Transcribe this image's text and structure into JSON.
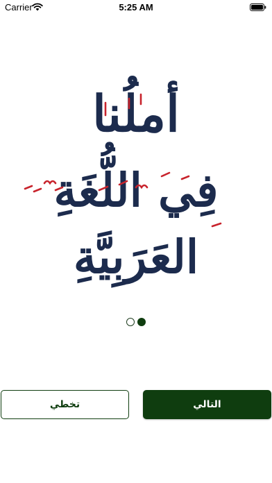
{
  "status_bar": {
    "carrier": "Carrier",
    "time": "5:25 AM",
    "wifi_icon": "wifi-icon",
    "battery_icon": "battery-icon"
  },
  "logo": {
    "line1": "أملُنا",
    "line2": "فِي اللُّغَةِ العَرَبِيَّةِ",
    "text_color": "#1c2b4d",
    "diacritic_color": "#c8232c"
  },
  "pager": {
    "page_count": 2,
    "current_page": 2
  },
  "buttons": {
    "skip_label": "تخطي",
    "next_label": "التالي",
    "accent_color": "#0f3d0f"
  }
}
